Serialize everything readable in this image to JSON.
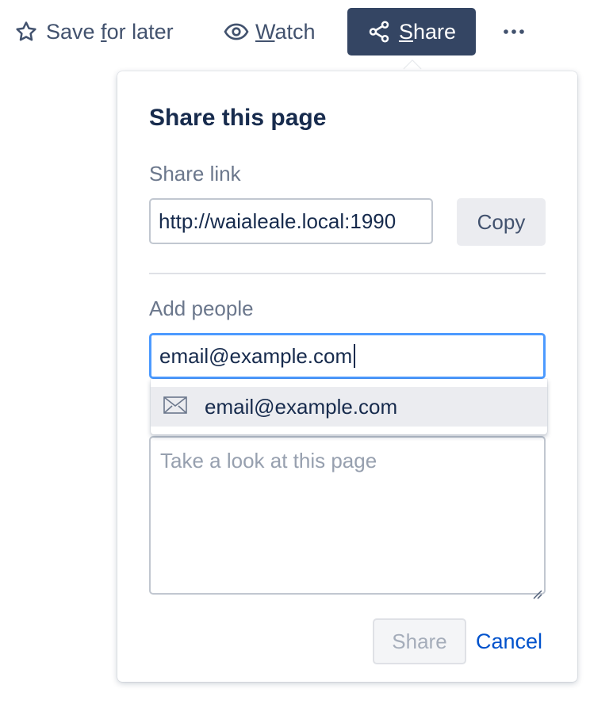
{
  "toolbar": {
    "save": {
      "first": "Save ",
      "ul": "f",
      "rest": "or later",
      "icon": "star-icon"
    },
    "watch": {
      "ul": "W",
      "rest": "atch",
      "icon": "eye-icon"
    },
    "share": {
      "ul": "S",
      "rest": "hare",
      "icon": "share-icon"
    },
    "more": {
      "label": "•••",
      "icon": "more-icon"
    }
  },
  "popup": {
    "title": "Share this page",
    "share_link_label": "Share link",
    "share_link_value": "http://waialeale.local:1990",
    "copy_label": "Copy",
    "add_people_label": "Add people",
    "add_people_value": "email@example.com",
    "suggestion": {
      "text": "email@example.com",
      "icon": "mail-icon"
    },
    "message_placeholder": "Take a look at this page",
    "share_label": "Share",
    "cancel_label": "Cancel"
  },
  "colors": {
    "share_button_bg": "#344563",
    "focus_border": "#4c9aff",
    "link": "#0052cc",
    "text": "#172b4d",
    "muted": "#6b778c"
  }
}
